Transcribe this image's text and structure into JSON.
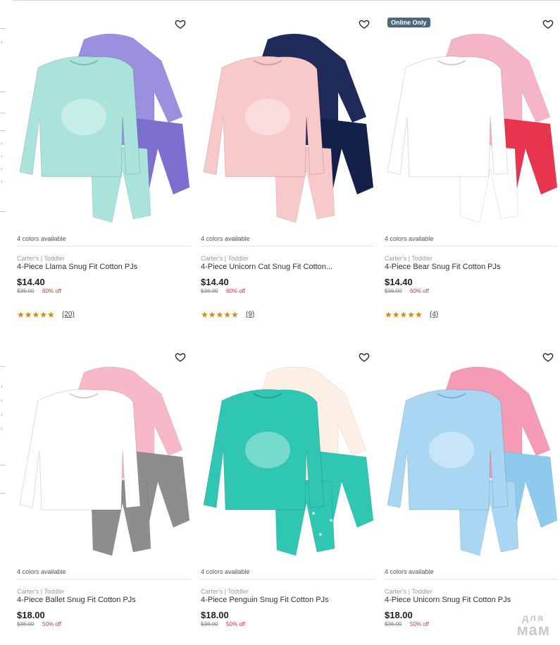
{
  "products": [
    {
      "colors_text": "4 colors available",
      "brand": "Carter's | Toddler",
      "title": "4-Piece Llama Snug Fit Cotton PJs",
      "price": "$14.40",
      "old_price": "$36.00",
      "discount": "60% off",
      "stars": "★★★★★",
      "reviews": "(20)",
      "badge": "",
      "palette": {
        "a": "#a9e3db",
        "b": "#9b8fe0",
        "c": "#7d6fcf"
      }
    },
    {
      "colors_text": "4 colors available",
      "brand": "Carter's | Toddler",
      "title": "4-Piece Unicorn Cat Snug Fit Cotton...",
      "price": "$14.40",
      "old_price": "$36.00",
      "discount": "60% off",
      "stars": "★★★★★",
      "reviews": "(9)",
      "badge": "",
      "palette": {
        "a": "#f8c9c9",
        "b": "#1f2a5a",
        "c": "#15204a"
      }
    },
    {
      "colors_text": "4 colors available",
      "brand": "Carter's | Toddler",
      "title": "4-Piece Bear Snug Fit Cotton PJs",
      "price": "$14.40",
      "old_price": "$36.00",
      "discount": "60% off",
      "stars": "★★★★★",
      "reviews": "(4)",
      "badge": "Online Only",
      "palette": {
        "a": "#ffffff",
        "b": "#f6b5c6",
        "c": "#e8344c"
      }
    },
    {
      "colors_text": "4 colors available",
      "brand": "Carter's | Toddler",
      "title": "4-Piece Ballet Snug Fit Cotton PJs",
      "price": "$18.00",
      "old_price": "$36.00",
      "discount": "50% off",
      "stars": "",
      "reviews": "",
      "badge": "",
      "palette": {
        "a": "#ffffff",
        "b": "#f7b9c8",
        "c": "#8d8d8d"
      }
    },
    {
      "colors_text": "4 colors available",
      "brand": "Carter's | Toddler",
      "title": "4-Piece Penguin Snug Fit Cotton PJs",
      "price": "$18.00",
      "old_price": "$36.00",
      "discount": "50% off",
      "stars": "",
      "reviews": "",
      "badge": "",
      "palette": {
        "a": "#2fc6b4",
        "b": "#fbefe6",
        "c": "#2fc6b4"
      }
    },
    {
      "colors_text": "4 colors available",
      "brand": "Carter's | Toddler",
      "title": "4-Piece Unicorn Snug Fit Cotton PJs",
      "price": "$18.00",
      "old_price": "$36.00",
      "discount": "50% off",
      "stars": "",
      "reviews": "",
      "badge": "",
      "palette": {
        "a": "#a9d7f3",
        "b": "#f59bb6",
        "c": "#8fc9ee"
      }
    }
  ],
  "watermark": {
    "line1": "для",
    "line2": "мам"
  }
}
